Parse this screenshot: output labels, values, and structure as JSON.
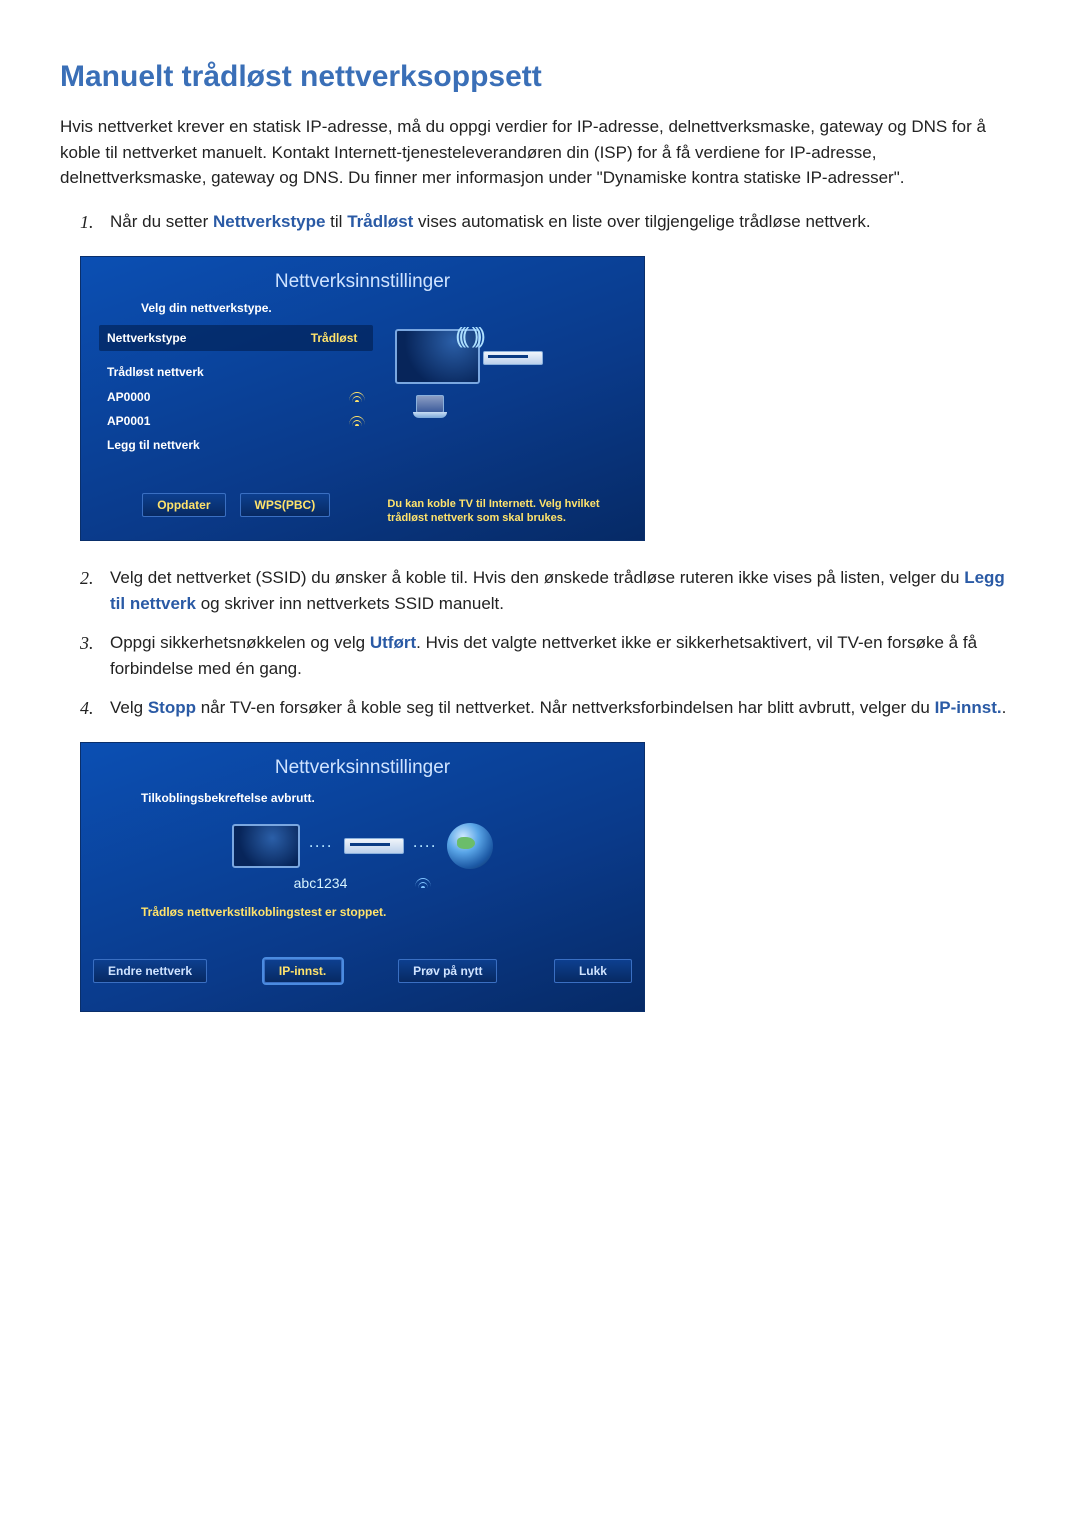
{
  "title": "Manuelt trådløst nettverksoppsett",
  "intro": "Hvis nettverket krever en statisk IP-adresse, må du oppgi verdier for IP-adresse, delnettverksmaske, gateway og DNS for å koble til nettverket manuelt. Kontakt Internett-tjenesteleverandøren din (ISP) for å få verdiene for IP-adresse, delnettverksmaske, gateway og DNS. Du finner mer informasjon under \"Dynamiske kontra statiske IP-adresser\".",
  "steps": {
    "n1": "1.",
    "n2": "2.",
    "n3": "3.",
    "n4": "4.",
    "s1_a": "Når du setter ",
    "s1_k1": "Nettverkstype",
    "s1_b": " til ",
    "s1_k2": "Trådløst",
    "s1_c": " vises automatisk en liste over tilgjengelige trådløse nettverk.",
    "s2_a": "Velg det nettverket (SSID) du ønsker å koble til. Hvis den ønskede trådløse ruteren ikke vises på listen, velger du ",
    "s2_k1": "Legg til nettverk",
    "s2_b": " og skriver inn nettverkets SSID manuelt.",
    "s3_a": "Oppgi sikkerhetsnøkkelen og velg ",
    "s3_k1": "Utført",
    "s3_b": ". Hvis det valgte nettverket ikke er sikkerhetsaktivert, vil TV-en forsøke å få forbindelse med én gang.",
    "s4_a": "Velg ",
    "s4_k1": "Stopp",
    "s4_b": " når TV-en forsøker å koble seg til nettverket. Når nettverksforbindelsen har blitt avbrutt, velger du ",
    "s4_k2": "IP-innst.",
    "s4_c": "."
  },
  "panel1": {
    "title": "Nettverksinnstillinger",
    "instr": "Velg din nettverkstype.",
    "type_label": "Nettverkstype",
    "type_value": "Trådløst",
    "wlan_label": "Trådløst nettverk",
    "networks": [
      "AP0000",
      "AP0001"
    ],
    "add_network": "Legg til nettverk",
    "btn_refresh": "Oppdater",
    "btn_wps": "WPS(PBC)",
    "hint": "Du kan koble TV til Internett. Velg hvilket trådløst nettverk som skal brukes."
  },
  "panel2": {
    "title": "Nettverksinnstillinger",
    "status": "Tilkoblingsbekreftelse avbrutt.",
    "ssid": "abc1234",
    "msg": "Trådløs nettverkstilkoblingstest er stoppet.",
    "btn_change": "Endre nettverk",
    "btn_ip": "IP-innst.",
    "btn_retry": "Prøv på nytt",
    "btn_close": "Lukk"
  }
}
